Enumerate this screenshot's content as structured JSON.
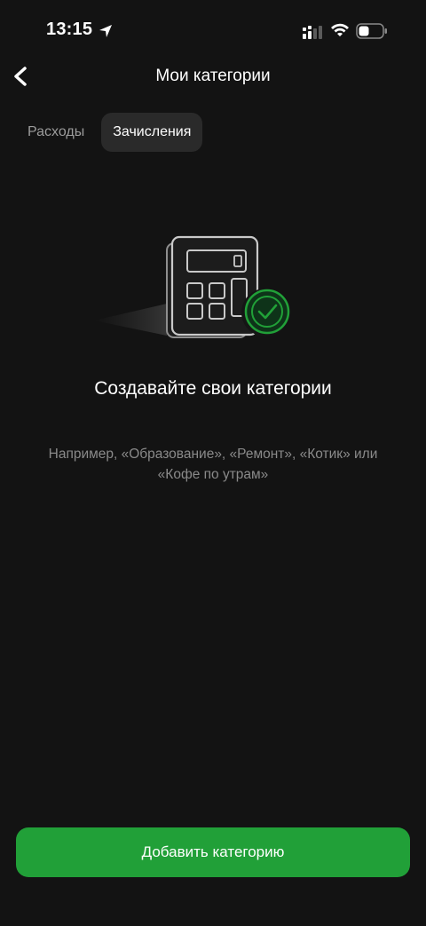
{
  "status_bar": {
    "time": "13:15",
    "icons": [
      "location-arrow-icon",
      "cellular-signal-icon",
      "wifi-icon",
      "battery-icon"
    ]
  },
  "header": {
    "back_icon": "chevron-left-icon",
    "title": "Мои категории"
  },
  "tabs": [
    {
      "label": "Расходы",
      "active": false
    },
    {
      "label": "Зачисления",
      "active": true
    }
  ],
  "empty_state": {
    "illustration": "calculator-with-checkmark",
    "title": "Создавайте свои категории",
    "description": "Например, «Образование», «Ремонт», «Котик» или «Кофе по утрам»"
  },
  "add_button": {
    "label": "Добавить категорию"
  },
  "colors": {
    "background": "#131313",
    "accent": "#21a038",
    "tab_active_bg": "#2a2a2a",
    "muted_text": "#8a8a8a"
  }
}
